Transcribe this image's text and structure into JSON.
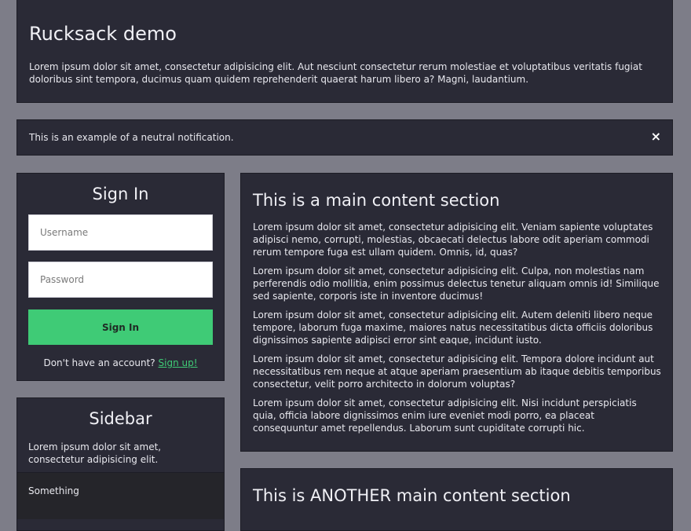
{
  "hero": {
    "title": "Rucksack demo",
    "text": "Lorem ipsum dolor sit amet, consectetur adipisicing elit. Aut nesciunt consectetur rerum molestiae et voluptatibus veritatis fugiat doloribus sint tempora, ducimus quam quidem reprehenderit quaerat harum libero a? Magni, laudantium."
  },
  "notification": {
    "message": "This is an example of a neutral notification.",
    "close_icon": "×"
  },
  "signin": {
    "title": "Sign In",
    "username_placeholder": "Username",
    "password_placeholder": "Password",
    "button_label": "Sign In",
    "prompt": "Don't have an account?",
    "signup_link": "Sign up!"
  },
  "sidebar": {
    "title": "Sidebar",
    "text": "Lorem ipsum dolor sit amet, consectetur adipisicing elit.",
    "items": [
      {
        "label": "Something"
      }
    ]
  },
  "main": {
    "sections": [
      {
        "title": "This is a main content section",
        "paragraphs": [
          "Lorem ipsum dolor sit amet, consectetur adipisicing elit. Veniam sapiente voluptates adipisci nemo, corrupti, molestias, obcaecati delectus labore odit aperiam commodi rerum tempore fuga est ullam quidem. Omnis, id, quas?",
          "Lorem ipsum dolor sit amet, consectetur adipisicing elit. Culpa, non molestias nam perferendis odio mollitia, enim possimus delectus tenetur aliquam omnis id! Similique sed sapiente, corporis iste in inventore ducimus!",
          "Lorem ipsum dolor sit amet, consectetur adipisicing elit. Autem deleniti libero neque tempore, laborum fuga maxime, maiores natus necessitatibus dicta officiis doloribus dignissimos sapiente adipisci error sint eaque, incidunt iusto.",
          "Lorem ipsum dolor sit amet, consectetur adipisicing elit. Tempora dolore incidunt aut necessitatibus rem neque at atque aperiam praesentium ab itaque debitis temporibus consectetur, velit porro architecto in dolorum voluptas?",
          "Lorem ipsum dolor sit amet, consectetur adipisicing elit. Nisi incidunt perspiciatis quia, officia labore dignissimos enim iure eveniet modi porro, ea placeat consequuntur amet repellendus. Laborum sunt cupiditate corrupti hic."
        ]
      },
      {
        "title": "This is ANOTHER main content section"
      }
    ]
  },
  "colors": {
    "background": "#7d7d88",
    "panel": "#2a2a36",
    "accent": "#3fcb76"
  }
}
